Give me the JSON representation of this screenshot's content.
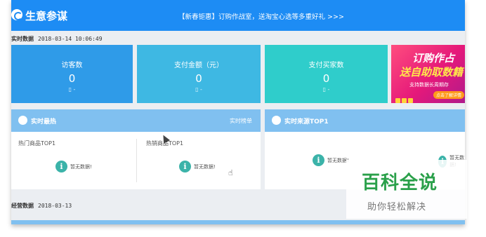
{
  "header": {
    "app_title": "生意参谋",
    "promo_text": "【新春钜惠】订购作战室，送淘宝心选等多重好礼 >>>"
  },
  "realtime": {
    "label": "实时数据",
    "datetime": "2018-03-14 10:06:49",
    "kpis": [
      {
        "label": "访客数",
        "value": "0",
        "device": "▯ -"
      },
      {
        "label": "支付金额（元）",
        "value": "0",
        "device": "▯ -"
      },
      {
        "label": "支付买家数",
        "value": "0",
        "device": "▯ -"
      }
    ],
    "colors": [
      "#2f9be8",
      "#3eb8e3",
      "#2fcdcb"
    ]
  },
  "banner": {
    "line1": "订购作占",
    "line2": "送自助取数籍",
    "line3": "支持数据长周期存",
    "cta": "点击了解详情"
  },
  "hot_panel": {
    "title": "实时榜单",
    "heading": "实时最热",
    "sub_left": "热门商品TOP1",
    "sub_right": "热销商品TOP1",
    "nodata_left": "暂无数据!",
    "nodata_right": "暂无数据!"
  },
  "source_panel": {
    "heading": "实时来源TOP1",
    "nodata_left": "暂无数据!",
    "nodata_right": "暂无数据!"
  },
  "operations": {
    "label": "经营数据",
    "date": "2018-03-13"
  },
  "watermark": {
    "title": "百科全说",
    "subtitle": "助你轻松解决"
  },
  "icons": {
    "logo": "compass-icon",
    "hot": "thumb-icon",
    "source": "link-icon",
    "info": "info-icon",
    "device": "mobile-icon"
  }
}
